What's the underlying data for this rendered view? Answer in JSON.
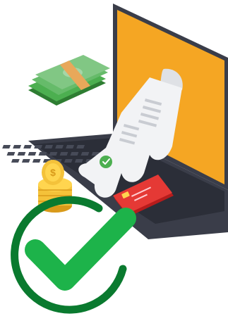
{
  "illustration": {
    "subject": "laptop-payment-receipt-success",
    "icons": [
      "laptop-icon",
      "banknotes-icon",
      "coins-icon",
      "receipt-icon",
      "credit-card-icon",
      "checkmark-icon"
    ],
    "colors": {
      "screen": "#f5a623",
      "laptop_body": "#3a3d49",
      "laptop_keys": "#2b2e38",
      "money": "#4caf50",
      "money_band": "#e8a85a",
      "coin": "#f4c23a",
      "coin_dark": "#d99a1a",
      "receipt": "#f2f3f5",
      "card": "#e53935",
      "check_ring": "#0a7a2f",
      "check_mark": "#1db34a"
    }
  }
}
